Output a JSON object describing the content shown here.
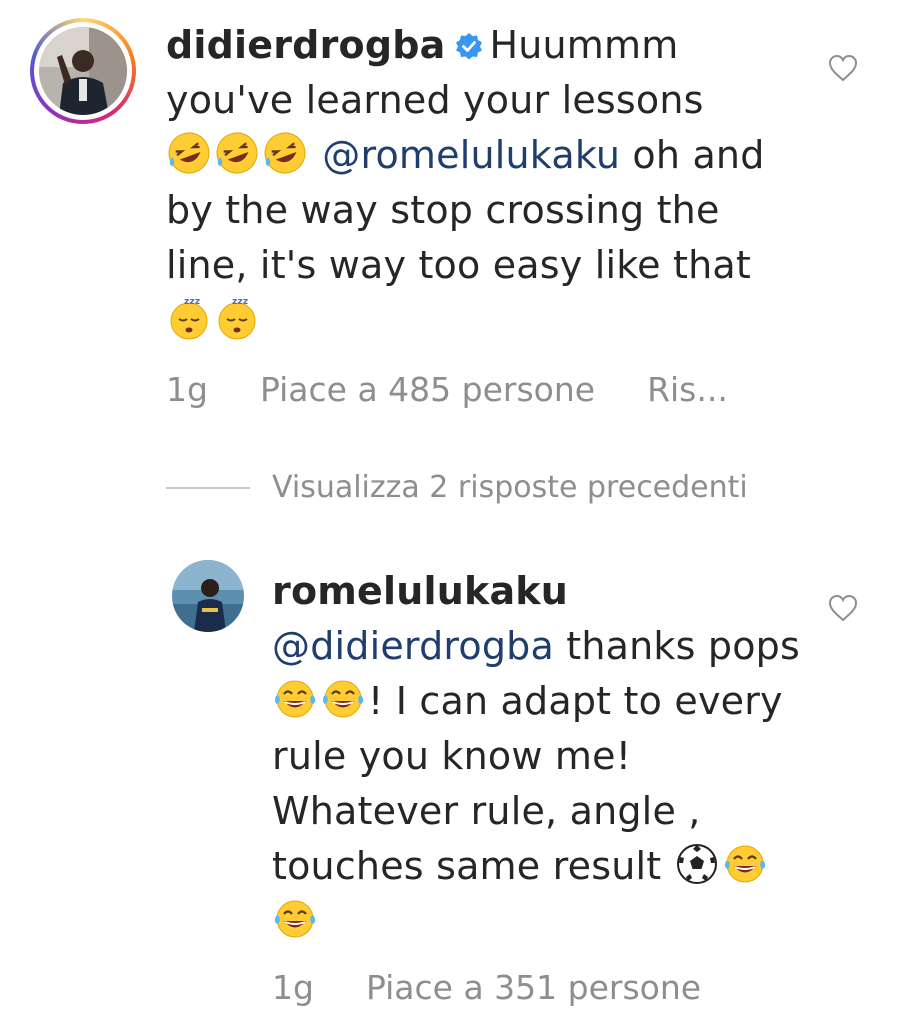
{
  "comment1": {
    "username": "didierdrogba",
    "verified": true,
    "text_part1": "Huummm you've learned your lessons",
    "emojis_1": [
      "rolling-on-floor-laughing",
      "rolling-on-floor-laughing",
      "rolling-on-floor-laughing"
    ],
    "mention": "@romelulukaku",
    "text_part2": " oh and by the way stop crossing the line, it's way too easy like that ",
    "emojis_2": [
      "sleeping-face",
      "sleeping-face"
    ],
    "time": "1g",
    "likes": "Piace a 485 persone",
    "reply": "Ris..."
  },
  "view_replies": {
    "label": "Visualizza 2 risposte precedenti"
  },
  "comment2": {
    "username": "romelulukaku",
    "mention": "@didierdrogba",
    "text_part1": " thanks pops ",
    "emojis_1": [
      "face-with-tears-of-joy",
      "face-with-tears-of-joy"
    ],
    "text_part2": "! I can adapt to every rule you know me! Whatever rule, angle , touches same result ",
    "emojis_2": [
      "soccer-ball",
      "face-with-tears-of-joy",
      "face-with-tears-of-joy"
    ],
    "time": "1g",
    "likes": "Piace a 351 persone"
  },
  "colors": {
    "text": "#262626",
    "mention": "#1f3e6e",
    "meta": "#8e8e8e",
    "verified": "#3897f0"
  }
}
